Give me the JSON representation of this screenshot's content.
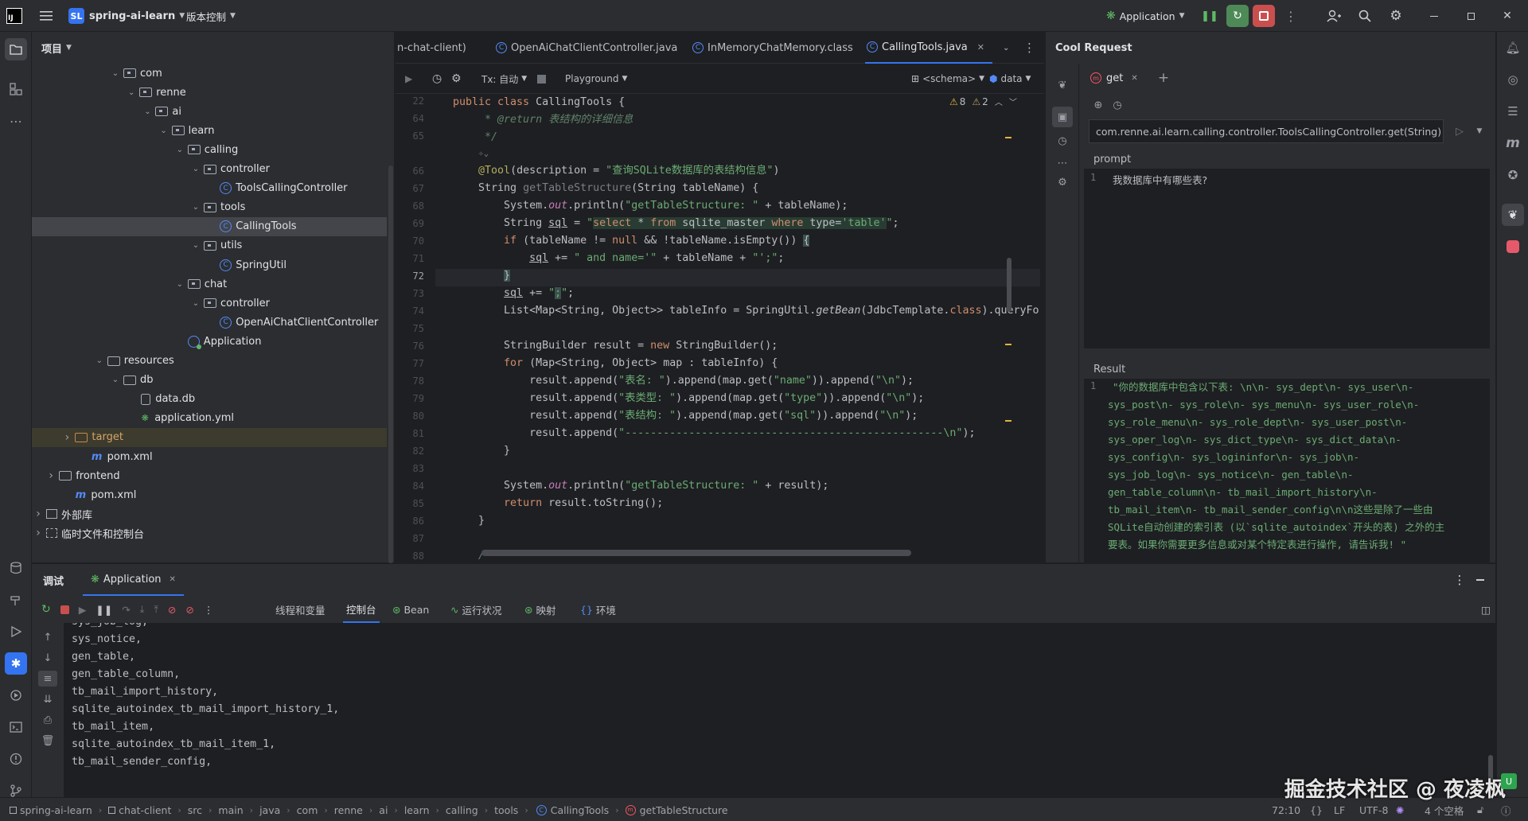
{
  "titlebar": {
    "project_badge": "SL",
    "project_name": "spring-ai-learn",
    "vcs_label": "版本控制",
    "run_config": "Application"
  },
  "project_panel": {
    "title": "项目",
    "tree": [
      {
        "label": "com",
        "type": "package",
        "depth": 5,
        "expanded": true
      },
      {
        "label": "renne",
        "type": "package",
        "depth": 6,
        "expanded": true
      },
      {
        "label": "ai",
        "type": "package",
        "depth": 7,
        "expanded": true
      },
      {
        "label": "learn",
        "type": "package",
        "depth": 8,
        "expanded": true
      },
      {
        "label": "calling",
        "type": "package",
        "depth": 9,
        "expanded": true
      },
      {
        "label": "controller",
        "type": "package",
        "depth": 10,
        "expanded": true
      },
      {
        "label": "ToolsCallingController",
        "type": "class",
        "depth": 11
      },
      {
        "label": "tools",
        "type": "package",
        "depth": 10,
        "expanded": true
      },
      {
        "label": "CallingTools",
        "type": "class",
        "depth": 11,
        "selected": true
      },
      {
        "label": "utils",
        "type": "package",
        "depth": 10,
        "expanded": true
      },
      {
        "label": "SpringUtil",
        "type": "class",
        "depth": 11
      },
      {
        "label": "chat",
        "type": "package",
        "depth": 9,
        "expanded": true
      },
      {
        "label": "controller",
        "type": "package",
        "depth": 10,
        "expanded": true
      },
      {
        "label": "OpenAiChatClientController",
        "type": "class",
        "depth": 11
      },
      {
        "label": "Application",
        "type": "app",
        "depth": 9
      },
      {
        "label": "resources",
        "type": "folder",
        "depth": 4,
        "expanded": true
      },
      {
        "label": "db",
        "type": "folder",
        "depth": 5,
        "expanded": true
      },
      {
        "label": "data.db",
        "type": "db",
        "depth": 6
      },
      {
        "label": "application.yml",
        "type": "yml",
        "depth": 6
      },
      {
        "label": "target",
        "type": "folder-orange",
        "depth": 2,
        "expanded": false,
        "highlight": true
      },
      {
        "label": "pom.xml",
        "type": "maven",
        "depth": 3
      },
      {
        "label": "frontend",
        "type": "folder",
        "depth": 1,
        "expanded": false
      },
      {
        "label": "pom.xml",
        "type": "maven",
        "depth": 2
      },
      {
        "label": "外部库",
        "type": "lib",
        "depth": 0,
        "expanded": false
      },
      {
        "label": "临时文件和控制台",
        "type": "scratch",
        "depth": 0,
        "expanded": false
      }
    ]
  },
  "editor": {
    "tabs": [
      {
        "label": "n-chat-client)",
        "active": false
      },
      {
        "label": "OpenAiChatClientController.java",
        "active": false
      },
      {
        "label": "InMemoryChatMemory.class",
        "active": false
      },
      {
        "label": "CallingTools.java",
        "active": true
      }
    ],
    "toolbar": {
      "tx_label": "Tx: 自动",
      "playground_label": "Playground",
      "schema_label": "<schema>",
      "data_label": "data"
    },
    "warnings": "8",
    "weak_warnings": "2",
    "line_numbers": [
      "22",
      "64",
      "65",
      "",
      "66",
      "67",
      "68",
      "69",
      "70",
      "71",
      "72",
      "73",
      "74",
      "75",
      "76",
      "77",
      "78",
      "79",
      "80",
      "81",
      "82",
      "83",
      "84",
      "85",
      "86",
      "87",
      "88"
    ],
    "current_line": "72",
    "class_header": "public class CallingTools {",
    "doc_return": "     * @return 表结构的详细信息",
    "doc_end": "     */",
    "annotation_line": "    @Tool(description = \"查询SQLite数据库的表结构信息\")",
    "method_sig": "    String getTableStructure(String tableName) {",
    "l68": "        System.out.println(\"getTableStructure: \" + tableName);",
    "l69": "        String sql = \"select * from sqlite_master where type='table'\";",
    "l70": "        if (tableName != null && !tableName.isEmpty()) {",
    "l71": "            sql += \" and name='\" + tableName + \"';\";",
    "l72": "        }",
    "l73": "        sql += \";\";",
    "l74": "        List<Map<String, Object>> tableInfo = SpringUtil.getBean(JdbcTemplate.class).queryFo",
    "l76": "        StringBuilder result = new StringBuilder();",
    "l77": "        for (Map<String, Object> map : tableInfo) {",
    "l78": "            result.append(\"表名: \").append(map.get(\"name\")).append(\"\\n\");",
    "l79": "            result.append(\"表类型: \").append(map.get(\"type\")).append(\"\\n\");",
    "l80": "            result.append(\"表结构: \").append(map.get(\"sql\")).append(\"\\n\");",
    "l81": "            result.append(\"--------------------------------------------------\\n\");",
    "l82": "        }",
    "l84": "        System.out.println(\"getTableStructure: \" + result);",
    "l85": "        return result.toString();",
    "l86": "    }",
    "l88": "    /**"
  },
  "cool_request": {
    "title": "Cool Request",
    "method_tab": "get",
    "url": "com.renne.ai.learn.calling.controller.ToolsCallingController.get(String)",
    "prompt_label": "prompt",
    "prompt_line_no": "1",
    "prompt_value": "我数据库中有哪些表?",
    "result_label": "Result",
    "result_line_no": "1",
    "result_lines": [
      "\"你的数据库中包含以下表: \\n\\n- sys_dept\\n- sys_user\\n-",
      "sys_post\\n- sys_role\\n- sys_menu\\n- sys_user_role\\n-",
      "sys_role_menu\\n- sys_role_dept\\n- sys_user_post\\n-",
      "sys_oper_log\\n- sys_dict_type\\n- sys_dict_data\\n-",
      "sys_config\\n- sys_logininfor\\n- sys_job\\n-",
      "sys_job_log\\n- sys_notice\\n- gen_table\\n-",
      "gen_table_column\\n- tb_mail_import_history\\n-",
      "tb_mail_item\\n- tb_mail_sender_config\\n\\n这些是除了一些由",
      "SQLite自动创建的索引表 (以`sqlite_autoindex`开头的表) 之外的主",
      "要表。如果你需要更多信息或对某个特定表进行操作, 请告诉我! \""
    ]
  },
  "debug": {
    "title": "调试",
    "session_tab": "Application",
    "subtabs": [
      "线程和变量",
      "控制台",
      "Bean",
      "运行状况",
      "映射",
      "环境"
    ],
    "active_subtab": "控制台",
    "console_lines": [
      "sys_job_log,",
      "sys_notice,",
      "gen_table,",
      "gen_table_column,",
      "tb_mail_import_history,",
      "sqlite_autoindex_tb_mail_import_history_1,",
      "tb_mail_item,",
      "sqlite_autoindex_tb_mail_item_1,",
      "tb_mail_sender_config,"
    ]
  },
  "statusbar": {
    "breadcrumb": [
      "spring-ai-learn",
      "chat-client",
      "src",
      "main",
      "java",
      "com",
      "renne",
      "ai",
      "learn",
      "calling",
      "tools",
      "CallingTools",
      "getTableStructure"
    ],
    "position": "72:10",
    "line_sep": "LF",
    "encoding": "UTF-8",
    "indent": "4 个空格"
  },
  "watermark": "掘金技术社区 @ 夜凌枫",
  "colors": {
    "accent": "#3574f0",
    "keyword": "#cf8e6d",
    "string": "#6aab73",
    "function": "#56a8f5"
  }
}
